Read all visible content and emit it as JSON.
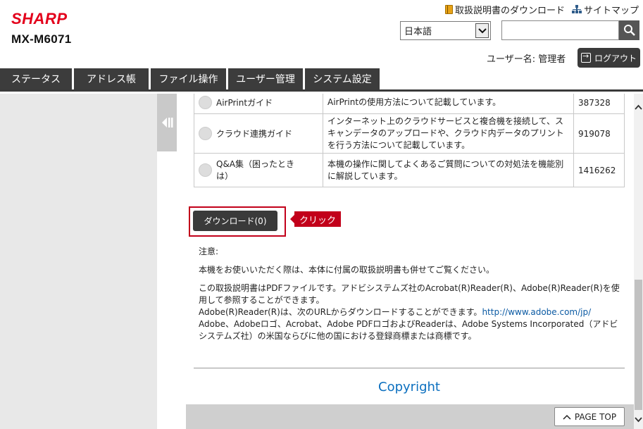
{
  "header": {
    "brand": "SHARP",
    "model": "MX-M6071",
    "links": {
      "manual_download": "取扱説明書のダウンロード",
      "sitemap": "サイトマップ"
    },
    "language": "日本語",
    "search_placeholder": "",
    "username": "ユーザー名: 管理者",
    "logout": "ログアウト"
  },
  "tabs": [
    "ステータス",
    "アドレス帳",
    "ファイル操作",
    "ユーザー管理",
    "システム設定"
  ],
  "guides": [
    {
      "name": "AirPrintガイド",
      "desc": "AirPrintの使用方法について記載しています。",
      "size": "387328"
    },
    {
      "name": "クラウド連携ガイド",
      "desc": "インターネット上のクラウドサービスと複合機を接続して、スキャンデータのアップロードや、クラウド内データのプリントを行う方法について記載しています。",
      "size": "919078"
    },
    {
      "name": "Q&A集（困ったときは）",
      "desc": "本機の操作に関してよくあるご質問についての対処法を機能別に解説しています。",
      "size": "1416262"
    }
  ],
  "download_button": "ダウンロード(0)",
  "click_callout": "クリック",
  "notes": {
    "heading": "注意:",
    "line1": "本機をお使いいただく際は、本体に付属の取扱説明書も併せてご覧ください。",
    "line2": "この取扱説明書はPDFファイルです。アドビシステムズ社のAcrobat(R)Reader(R)、Adobe(R)Reader(R)を使用して参照することができます。",
    "line3_prefix": "Adobe(R)Reader(R)は、次のURLからダウンロードすることができます。",
    "line3_url": "http://www.adobe.com/jp/",
    "line4": "Adobe、Adobeロゴ、Acrobat、Adobe PDFロゴおよびReaderは、Adobe Systems Incorporated（アドビシステムズ社）の米国ならびに他の国における登録商標または商標です。"
  },
  "copyright": "Copyright",
  "page_top": "PAGE TOP",
  "colors": {
    "brand_red": "#e3001b",
    "tab_bg": "#3c3c3c",
    "link_blue": "#0b6fbf",
    "callout_red": "#c2001a"
  }
}
